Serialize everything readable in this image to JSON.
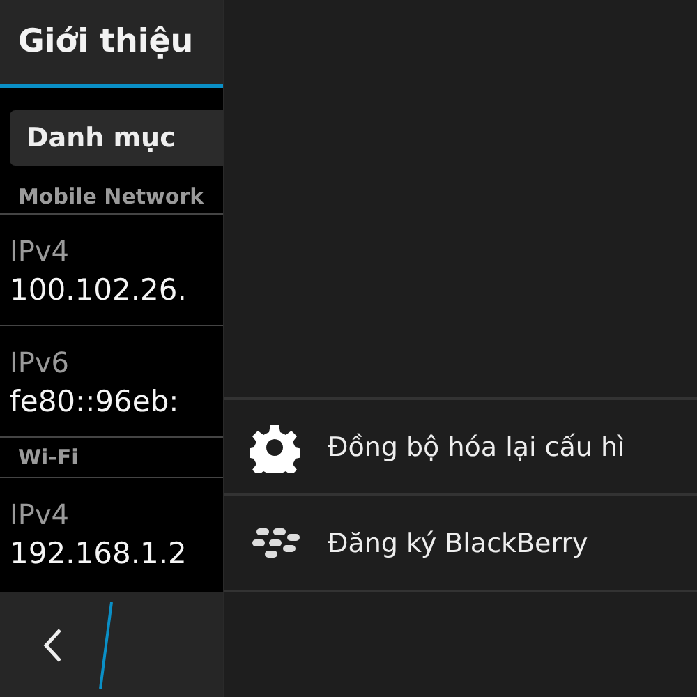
{
  "header": {
    "title": "Giới thiệu"
  },
  "dropdown": {
    "label": "Danh mục"
  },
  "sections": [
    {
      "title": "Mobile Network",
      "rows": [
        {
          "label": "IPv4",
          "value": "100.102.26."
        },
        {
          "label": "IPv6",
          "value": "fe80::96eb:"
        }
      ]
    },
    {
      "title": "Wi-Fi",
      "rows": [
        {
          "label": "IPv4",
          "value": "192.168.1.2"
        }
      ]
    }
  ],
  "menu": {
    "items": [
      {
        "kind": "gear",
        "label": "Đồng bộ hóa lại cấu hì"
      },
      {
        "kind": "blackberry",
        "label": "Đăng ký BlackBerry"
      }
    ]
  }
}
